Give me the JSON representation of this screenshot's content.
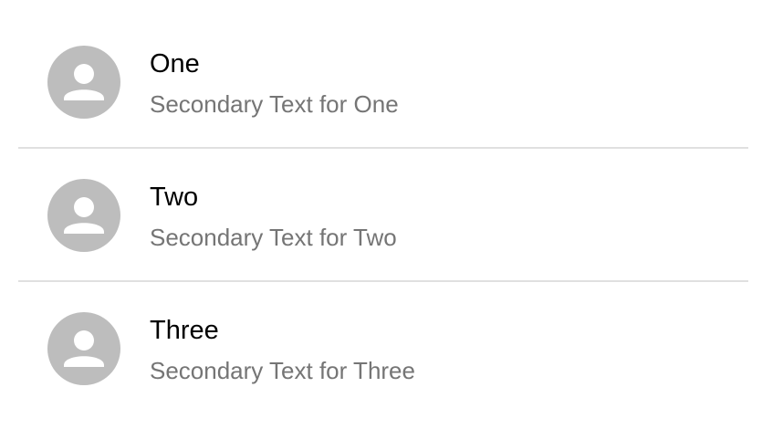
{
  "list": {
    "items": [
      {
        "primary": "One",
        "secondary": "Secondary Text for One",
        "avatar_icon": "person-icon"
      },
      {
        "primary": "Two",
        "secondary": "Secondary Text for Two",
        "avatar_icon": "person-icon"
      },
      {
        "primary": "Three",
        "secondary": "Secondary Text for Three",
        "avatar_icon": "person-icon"
      }
    ]
  },
  "colors": {
    "avatar_background": "#bdbdbd",
    "avatar_icon": "#ffffff",
    "primary_text": "#000000",
    "secondary_text": "#757575",
    "divider": "#e0e0e0"
  }
}
